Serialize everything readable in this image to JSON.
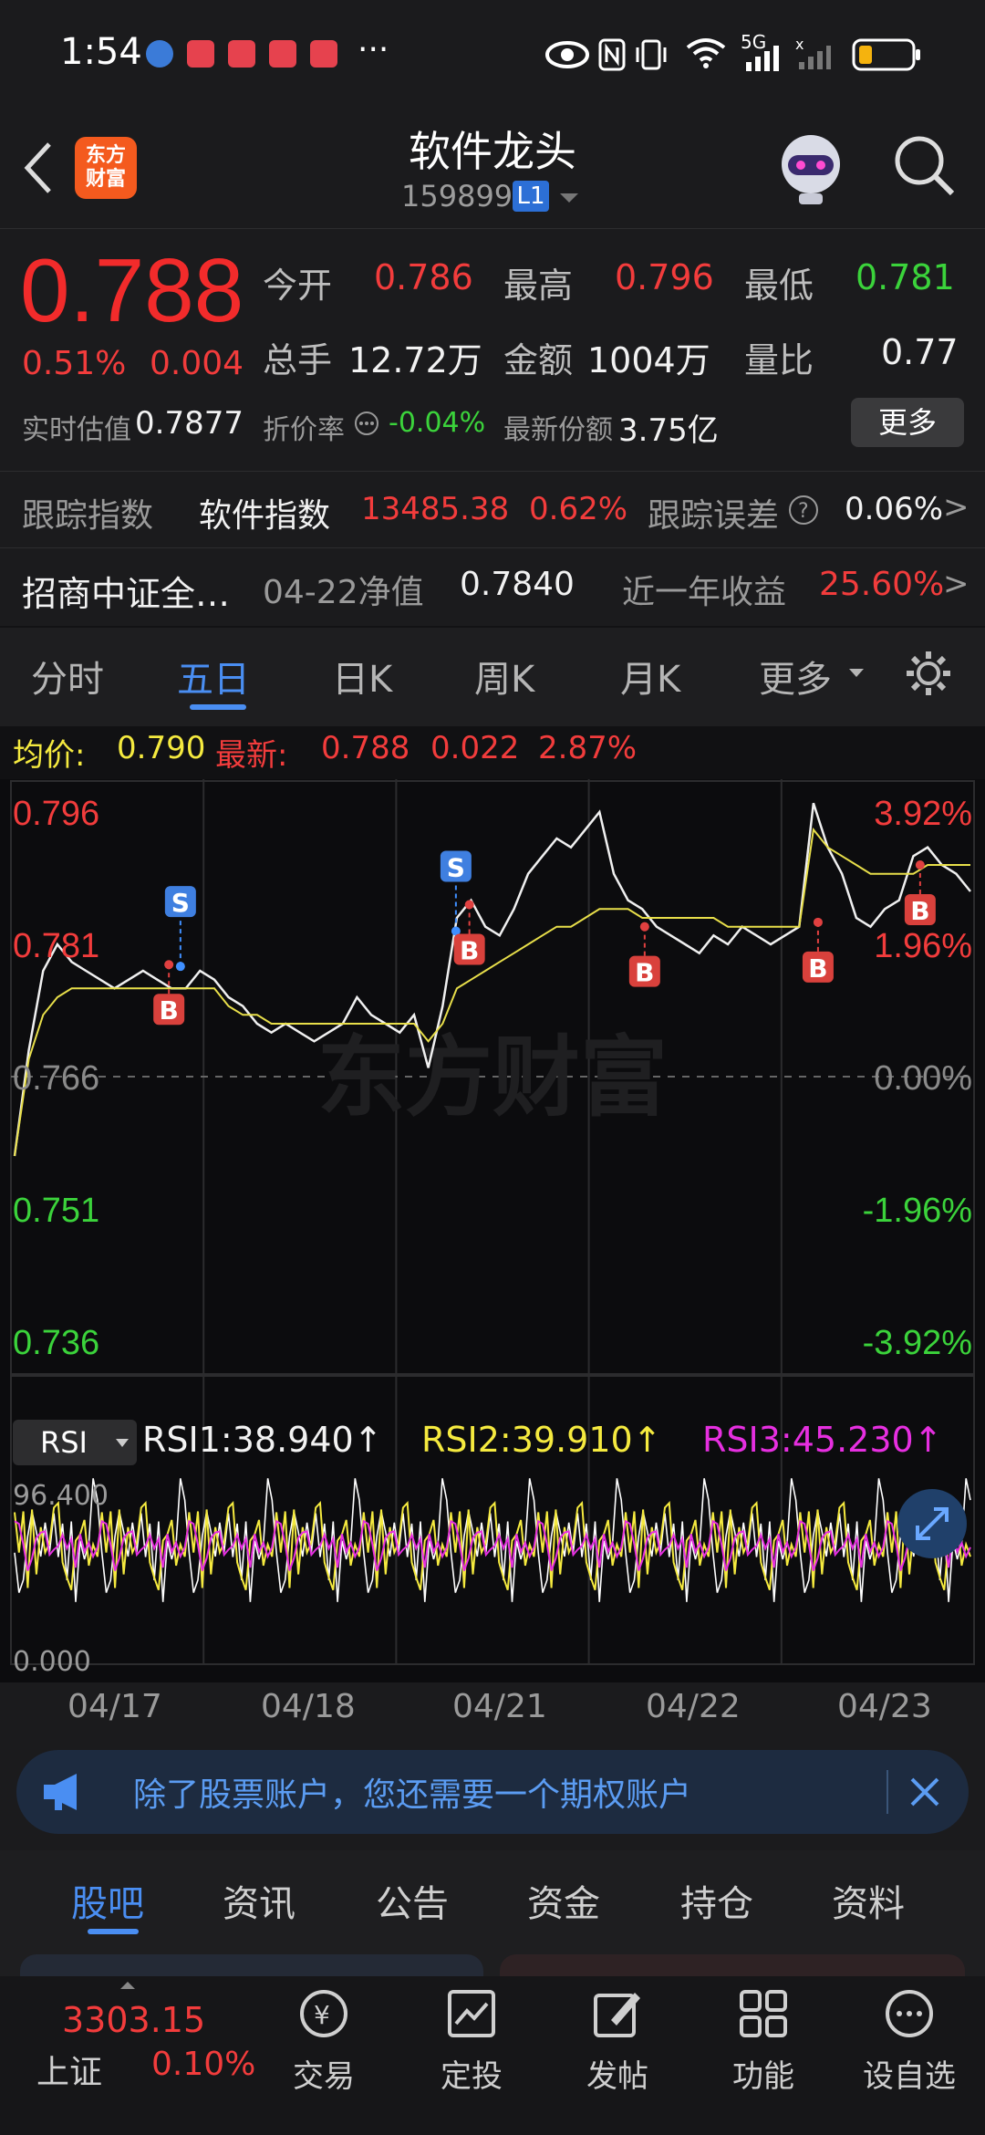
{
  "status_bar": {
    "time": "1:54",
    "network": "5G"
  },
  "header": {
    "title": "软件龙头",
    "code": "159899",
    "level_badge": "L1",
    "logo_text": "东方财富"
  },
  "quote": {
    "price": "0.788",
    "change_pct": "0.51%",
    "change": "0.004",
    "open_label": "今开",
    "open": "0.786",
    "high_label": "最高",
    "high": "0.796",
    "low_label": "最低",
    "low": "0.781",
    "volume_label": "总手",
    "volume": "12.72万",
    "amount_label": "金额",
    "amount": "1004万",
    "vol_ratio_label": "量比",
    "vol_ratio": "0.77",
    "iopv_label": "实时估值",
    "iopv": "0.7877",
    "discount_label": "折价率",
    "discount": "-0.04%",
    "shares_label": "最新份额",
    "shares": "3.75亿",
    "more_button": "更多"
  },
  "tracking": {
    "index_label": "跟踪指数",
    "index_name": "软件指数",
    "index_value": "13485.38",
    "index_change": "0.62%",
    "error_label": "跟踪误差",
    "error_value": "0.06%"
  },
  "fund": {
    "name": "招商中证全…",
    "nav_label": "04-22净值",
    "nav": "0.7840",
    "return_label": "近一年收益",
    "return_value": "25.60%"
  },
  "period_tabs": [
    "分时",
    "五日",
    "日K",
    "周K",
    "月K",
    "更多"
  ],
  "active_period": "五日",
  "chart_info": {
    "avg_label": "均价:",
    "avg_value": "0.790",
    "latest_label": "最新:",
    "latest_value": "0.788",
    "latest_change": "0.022",
    "latest_pct": "2.87%"
  },
  "chart_data": {
    "type": "line",
    "watermark": "东方财富",
    "y_labels_left": [
      "0.796",
      "0.781",
      "0.766",
      "0.751",
      "0.736"
    ],
    "y_labels_right": [
      "3.92%",
      "1.96%",
      "0.00%",
      "-1.96%",
      "-3.92%"
    ],
    "ylim": [
      0.736,
      0.796
    ],
    "x_categories": [
      "04/17",
      "04/18",
      "04/21",
      "04/22",
      "04/23"
    ],
    "series": [
      {
        "name": "price",
        "color": "#f0f0f0",
        "values": [
          0.757,
          0.769,
          0.778,
          0.781,
          0.779,
          0.778,
          0.777,
          0.776,
          0.777,
          0.778,
          0.777,
          0.776,
          0.776,
          0.778,
          0.777,
          0.775,
          0.774,
          0.772,
          0.771,
          0.772,
          0.771,
          0.77,
          0.771,
          0.772,
          0.775,
          0.773,
          0.772,
          0.771,
          0.773,
          0.767,
          0.774,
          0.784,
          0.786,
          0.783,
          0.782,
          0.785,
          0.789,
          0.791,
          0.793,
          0.792,
          0.794,
          0.796,
          0.789,
          0.786,
          0.785,
          0.783,
          0.782,
          0.781,
          0.78,
          0.782,
          0.781,
          0.783,
          0.782,
          0.781,
          0.782,
          0.783,
          0.797,
          0.792,
          0.789,
          0.784,
          0.783,
          0.785,
          0.786,
          0.791,
          0.792,
          0.79,
          0.789,
          0.787
        ]
      },
      {
        "name": "avg",
        "color": "#e8df4a",
        "values": [
          0.757,
          0.768,
          0.773,
          0.775,
          0.776,
          0.776,
          0.776,
          0.776,
          0.776,
          0.776,
          0.776,
          0.776,
          0.776,
          0.776,
          0.776,
          0.774,
          0.773,
          0.773,
          0.772,
          0.772,
          0.772,
          0.772,
          0.772,
          0.772,
          0.772,
          0.772,
          0.772,
          0.772,
          0.772,
          0.77,
          0.772,
          0.776,
          0.777,
          0.778,
          0.779,
          0.78,
          0.781,
          0.782,
          0.783,
          0.783,
          0.784,
          0.785,
          0.785,
          0.785,
          0.784,
          0.784,
          0.784,
          0.784,
          0.784,
          0.784,
          0.783,
          0.783,
          0.783,
          0.783,
          0.783,
          0.783,
          0.794,
          0.792,
          0.791,
          0.79,
          0.789,
          0.789,
          0.789,
          0.789,
          0.79,
          0.79,
          0.79,
          0.79
        ]
      }
    ],
    "markers": [
      {
        "label": "S",
        "day": 0.88,
        "value": 0.7785
      },
      {
        "label": "B",
        "day": 0.82,
        "value": 0.7787
      },
      {
        "label": "S",
        "day": 2.31,
        "value": 0.7825
      },
      {
        "label": "B",
        "day": 2.38,
        "value": 0.7855
      },
      {
        "label": "B",
        "day": 3.29,
        "value": 0.783
      },
      {
        "label": "B",
        "day": 4.19,
        "value": 0.7835
      },
      {
        "label": "B",
        "day": 4.72,
        "value": 0.79
      }
    ]
  },
  "rsi": {
    "selector": "RSI",
    "rsi1": "RSI1:38.940↑",
    "rsi2": "RSI2:39.910↑",
    "rsi3": "RSI3:45.230↑",
    "max_label": "96.400",
    "min_label": "0.000",
    "colors": {
      "rsi1": "#ffffff",
      "rsi2": "#f5ea3f",
      "rsi3": "#e62fe0"
    }
  },
  "banner": {
    "text": "除了股票账户，您还需要一个期权账户"
  },
  "bottom_tabs": [
    "股吧",
    "资讯",
    "公告",
    "资金",
    "持仓",
    "资料"
  ],
  "active_bottom_tab": "股吧",
  "bottom_nav": {
    "index_value": "3303.15",
    "index_name": "上证",
    "index_change": "0.10%",
    "items": [
      "交易",
      "定投",
      "发帖",
      "功能",
      "设自选"
    ]
  },
  "colors": {
    "up": "#f22b2b",
    "down": "#3bd33b",
    "accent": "#4a8ef2",
    "bg": "#1b1b1d"
  }
}
